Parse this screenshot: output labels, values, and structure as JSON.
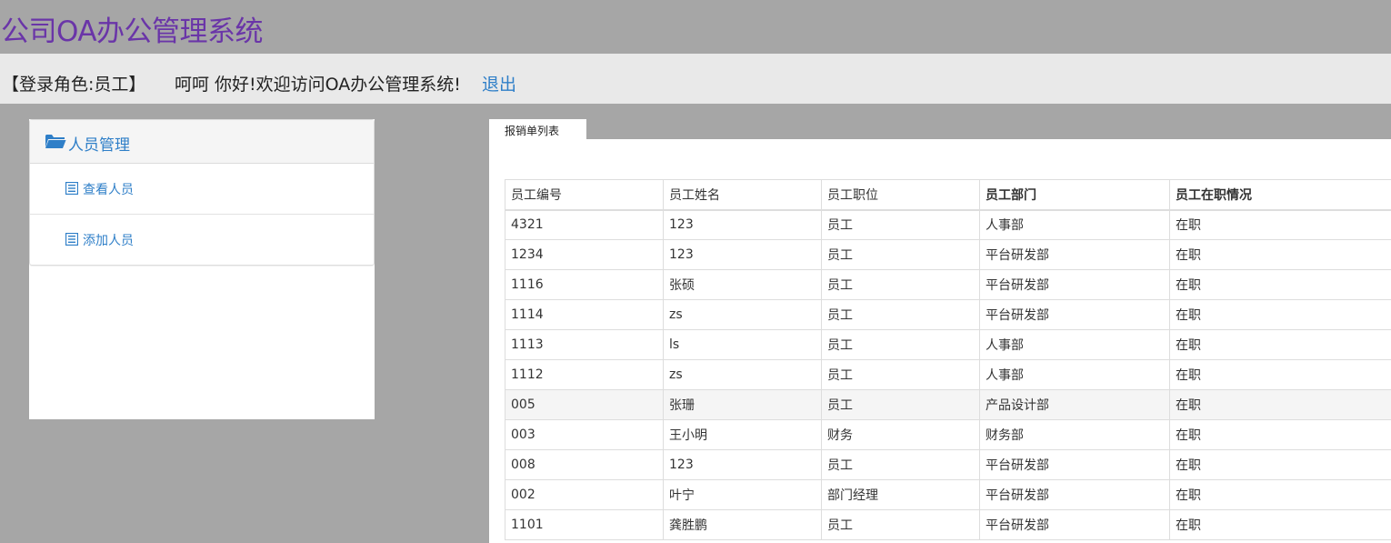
{
  "header": {
    "title": "公司OA办公管理系统"
  },
  "infobar": {
    "role": "【登录角色:员工】",
    "welcome": "呵呵 你好!欢迎访问OA办公管理系统!",
    "logout": "退出"
  },
  "sidebar": {
    "panel_title": "人员管理",
    "items": [
      {
        "label": "查看人员",
        "icon": "list-icon"
      },
      {
        "label": "添加人员",
        "icon": "list-icon"
      }
    ]
  },
  "tab": {
    "label": "报销单列表"
  },
  "table": {
    "headers": [
      "员工编号",
      "员工姓名",
      "员工职位",
      "员工部门",
      "员工在职情况"
    ],
    "rows": [
      [
        "4321",
        "123",
        "员工",
        "人事部",
        "在职"
      ],
      [
        "1234",
        "123",
        "员工",
        "平台研发部",
        "在职"
      ],
      [
        "1116",
        "张硕",
        "员工",
        "平台研发部",
        "在职"
      ],
      [
        "1114",
        "zs",
        "员工",
        "平台研发部",
        "在职"
      ],
      [
        "1113",
        "ls",
        "员工",
        "人事部",
        "在职"
      ],
      [
        "1112",
        "zs",
        "员工",
        "人事部",
        "在职"
      ],
      [
        "005",
        "张珊",
        "员工",
        "产品设计部",
        "在职"
      ],
      [
        "003",
        "王小明",
        "财务",
        "财务部",
        "在职"
      ],
      [
        "008",
        "123",
        "员工",
        "平台研发部",
        "在职"
      ],
      [
        "002",
        "叶宁",
        "部门经理",
        "平台研发部",
        "在职"
      ],
      [
        "1101",
        "龚胜鹏",
        "员工",
        "平台研发部",
        "在职"
      ]
    ]
  },
  "colors": {
    "title": "#6a35a8",
    "link": "#2f7fc8",
    "background": "#a6a6a6",
    "infobar": "#e9e9e9"
  }
}
